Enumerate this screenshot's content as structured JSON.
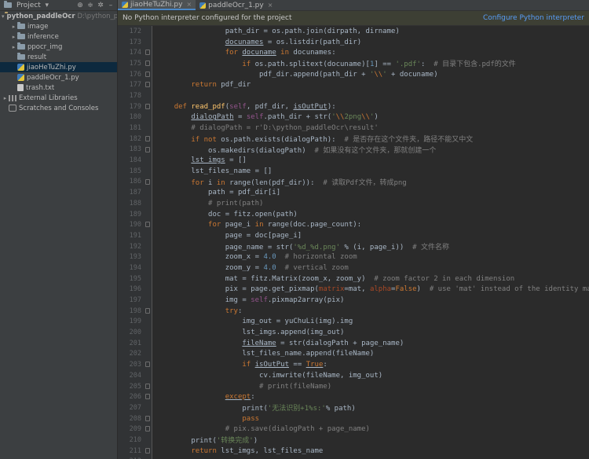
{
  "project_panel": {
    "title": "Project",
    "tree": [
      {
        "label": "python_paddleOcr",
        "hint": "D:\\python_p",
        "kind": "root",
        "indent": 0,
        "arrow": "▾",
        "bold": true
      },
      {
        "label": "image",
        "kind": "folder",
        "indent": 1,
        "arrow": "▸"
      },
      {
        "label": "inference",
        "kind": "folder",
        "indent": 1,
        "arrow": "▸"
      },
      {
        "label": "ppocr_img",
        "kind": "folder",
        "indent": 1,
        "arrow": "▸"
      },
      {
        "label": "result",
        "kind": "folder",
        "indent": 1,
        "arrow": ""
      },
      {
        "label": "jiaoHeTuZhi.py",
        "kind": "py",
        "indent": 1,
        "arrow": "",
        "selected": true
      },
      {
        "label": "paddleOcr_1.py",
        "kind": "py",
        "indent": 1,
        "arrow": ""
      },
      {
        "label": "trash.txt",
        "kind": "txt",
        "indent": 1,
        "arrow": ""
      },
      {
        "label": "External Libraries",
        "kind": "lib",
        "indent": 0,
        "arrow": "▸"
      },
      {
        "label": "Scratches and Consoles",
        "kind": "scratch",
        "indent": 0,
        "arrow": ""
      }
    ]
  },
  "tabs": [
    {
      "label": "jiaoHeTuZhi.py",
      "active": true
    },
    {
      "label": "paddleOcr_1.py",
      "active": false
    }
  ],
  "notice": {
    "message": "No Python interpreter configured for the project",
    "action": "Configure Python interpreter"
  },
  "editor": {
    "lines": [
      {
        "n": "172",
        "fold": false,
        "html": "                <span>path_dir = os.path.join(dirpath, dirname)</span>"
      },
      {
        "n": "173",
        "fold": false,
        "html": "                <span class=\"und\">docunames</span> = os.listdir(path_dir)"
      },
      {
        "n": "174",
        "fold": true,
        "html": "                <span class=\"kw\">for</span> <span class=\"und\">docuname</span> <span class=\"kw\">in</span> docunames:"
      },
      {
        "n": "175",
        "fold": true,
        "html": "                    <span class=\"kw\">if</span> os.path.splitext(docuname)[<span class=\"num\">1</span>] == <span class=\"str\">'.pdf'</span>:  <span class=\"cm\"># 目录下包含.pdf的文件</span>"
      },
      {
        "n": "176",
        "fold": true,
        "html": "                        pdf_dir.append(path_dir + <span class=\"str\">'<span class=\"esc\">\\\\</span>'</span> + docuname)"
      },
      {
        "n": "177",
        "fold": true,
        "html": "        <span class=\"kw\">return</span> pdf_dir"
      },
      {
        "n": "178",
        "fold": false,
        "html": ""
      },
      {
        "n": "179",
        "fold": true,
        "html": "    <span class=\"kw\">def</span> <span class=\"fn\">read_pdf</span>(<span class=\"slf\">self</span>, pdf_dir, <span class=\"und\">isOutPut</span>):"
      },
      {
        "n": "180",
        "fold": false,
        "html": "        <span class=\"und\">dialogPath</span> = <span class=\"slf\">self</span>.path_dir + str(<span class=\"str\">'<span class=\"esc\">\\\\</span>2png<span class=\"esc\">\\\\</span>'</span>)"
      },
      {
        "n": "181",
        "fold": false,
        "html": "        <span class=\"cm\"># dialogPath = r'D:\\python_paddleOcr\\result'</span>"
      },
      {
        "n": "182",
        "fold": true,
        "html": "        <span class=\"kw\">if not</span> os.path.exists(dialogPath):  <span class=\"cm\"># 是否存在这个文件夹，路径不能又中文</span>"
      },
      {
        "n": "183",
        "fold": true,
        "html": "            os.makedirs(dialogPath)  <span class=\"cm\"># 如果没有这个文件夹，那就创建一个</span>"
      },
      {
        "n": "184",
        "fold": false,
        "html": "        <span class=\"und\">lst_imgs</span> = []"
      },
      {
        "n": "185",
        "fold": false,
        "html": "        lst_files_name = []"
      },
      {
        "n": "186",
        "fold": true,
        "html": "        <span class=\"kw\">for</span> i <span class=\"kw\">in</span> range(len(pdf_dir)):  <span class=\"cm\"># 读取Pdf文件，转成png</span>"
      },
      {
        "n": "187",
        "fold": false,
        "html": "            path = pdf_dir[i]"
      },
      {
        "n": "188",
        "fold": false,
        "html": "            <span class=\"cm\"># print(path)</span>"
      },
      {
        "n": "189",
        "fold": false,
        "html": "            doc = fitz.open(path)"
      },
      {
        "n": "190",
        "fold": true,
        "html": "            <span class=\"kw\">for</span> page_i <span class=\"kw\">in</span> range(doc.page_count):"
      },
      {
        "n": "191",
        "fold": false,
        "html": "                page = doc[page_i]"
      },
      {
        "n": "192",
        "fold": false,
        "html": "                page_name = str(<span class=\"str\">'%d_%d.png'</span> % (i, page_i))  <span class=\"cm\"># 文件名称</span>"
      },
      {
        "n": "193",
        "fold": false,
        "html": "                zoom_x = <span class=\"num\">4.0</span>  <span class=\"cm\"># horizontal zoom</span>"
      },
      {
        "n": "194",
        "fold": false,
        "html": "                zoom_y = <span class=\"num\">4.0</span>  <span class=\"cm\"># vertical zoom</span>"
      },
      {
        "n": "195",
        "fold": false,
        "html": "                mat = fitz.Matrix(zoom_x, zoom_y)  <span class=\"cm\"># zoom factor 2 in each dimension</span>"
      },
      {
        "n": "196",
        "fold": false,
        "html": "                pix = page.get_pixmap(<span class=\"prm\">matrix</span>=mat, <span class=\"prm\">alpha</span>=<span class=\"kw\">False</span>)  <span class=\"cm\"># use 'mat' instead of the identity matrix</span>"
      },
      {
        "n": "197",
        "fold": false,
        "html": "                img = <span class=\"slf\">self</span>.pixmap2array(pix)"
      },
      {
        "n": "198",
        "fold": true,
        "html": "                <span class=\"kw\">try</span>:"
      },
      {
        "n": "199",
        "fold": false,
        "html": "                    img_out = yuChuLi(img).img"
      },
      {
        "n": "200",
        "fold": false,
        "html": "                    lst_imgs.append(img_out)"
      },
      {
        "n": "201",
        "fold": false,
        "html": "                    <span class=\"und\">fileName</span> = str(dialogPath + page_name)"
      },
      {
        "n": "202",
        "fold": false,
        "html": "                    lst_files_name.append(fileName)"
      },
      {
        "n": "203",
        "fold": true,
        "html": "                    <span class=\"kw\">if</span> <span class=\"und\">isOutPut</span> == <span class=\"kw und\">True</span>:"
      },
      {
        "n": "204",
        "fold": false,
        "html": "                        cv.imwrite(fileName, img_out)"
      },
      {
        "n": "205",
        "fold": true,
        "html": "                        <span class=\"cm\"># print(fileName)</span>"
      },
      {
        "n": "206",
        "fold": true,
        "html": "                <span class=\"kw und\">except</span>:"
      },
      {
        "n": "207",
        "fold": false,
        "html": "                    print(<span class=\"str\">'无法识别+1%s:'</span>% path)"
      },
      {
        "n": "208",
        "fold": true,
        "html": "                    <span class=\"kw\">pass</span>"
      },
      {
        "n": "209",
        "fold": true,
        "html": "                <span class=\"cm\"># pix.save(dialogPath + page_name)</span>"
      },
      {
        "n": "210",
        "fold": false,
        "html": "        print(<span class=\"str\">'转换完成'</span>)"
      },
      {
        "n": "211",
        "fold": true,
        "html": "        <span class=\"kw\">return</span> lst_imgs, lst_files_name"
      },
      {
        "n": "212",
        "fold": false,
        "html": ""
      }
    ]
  }
}
